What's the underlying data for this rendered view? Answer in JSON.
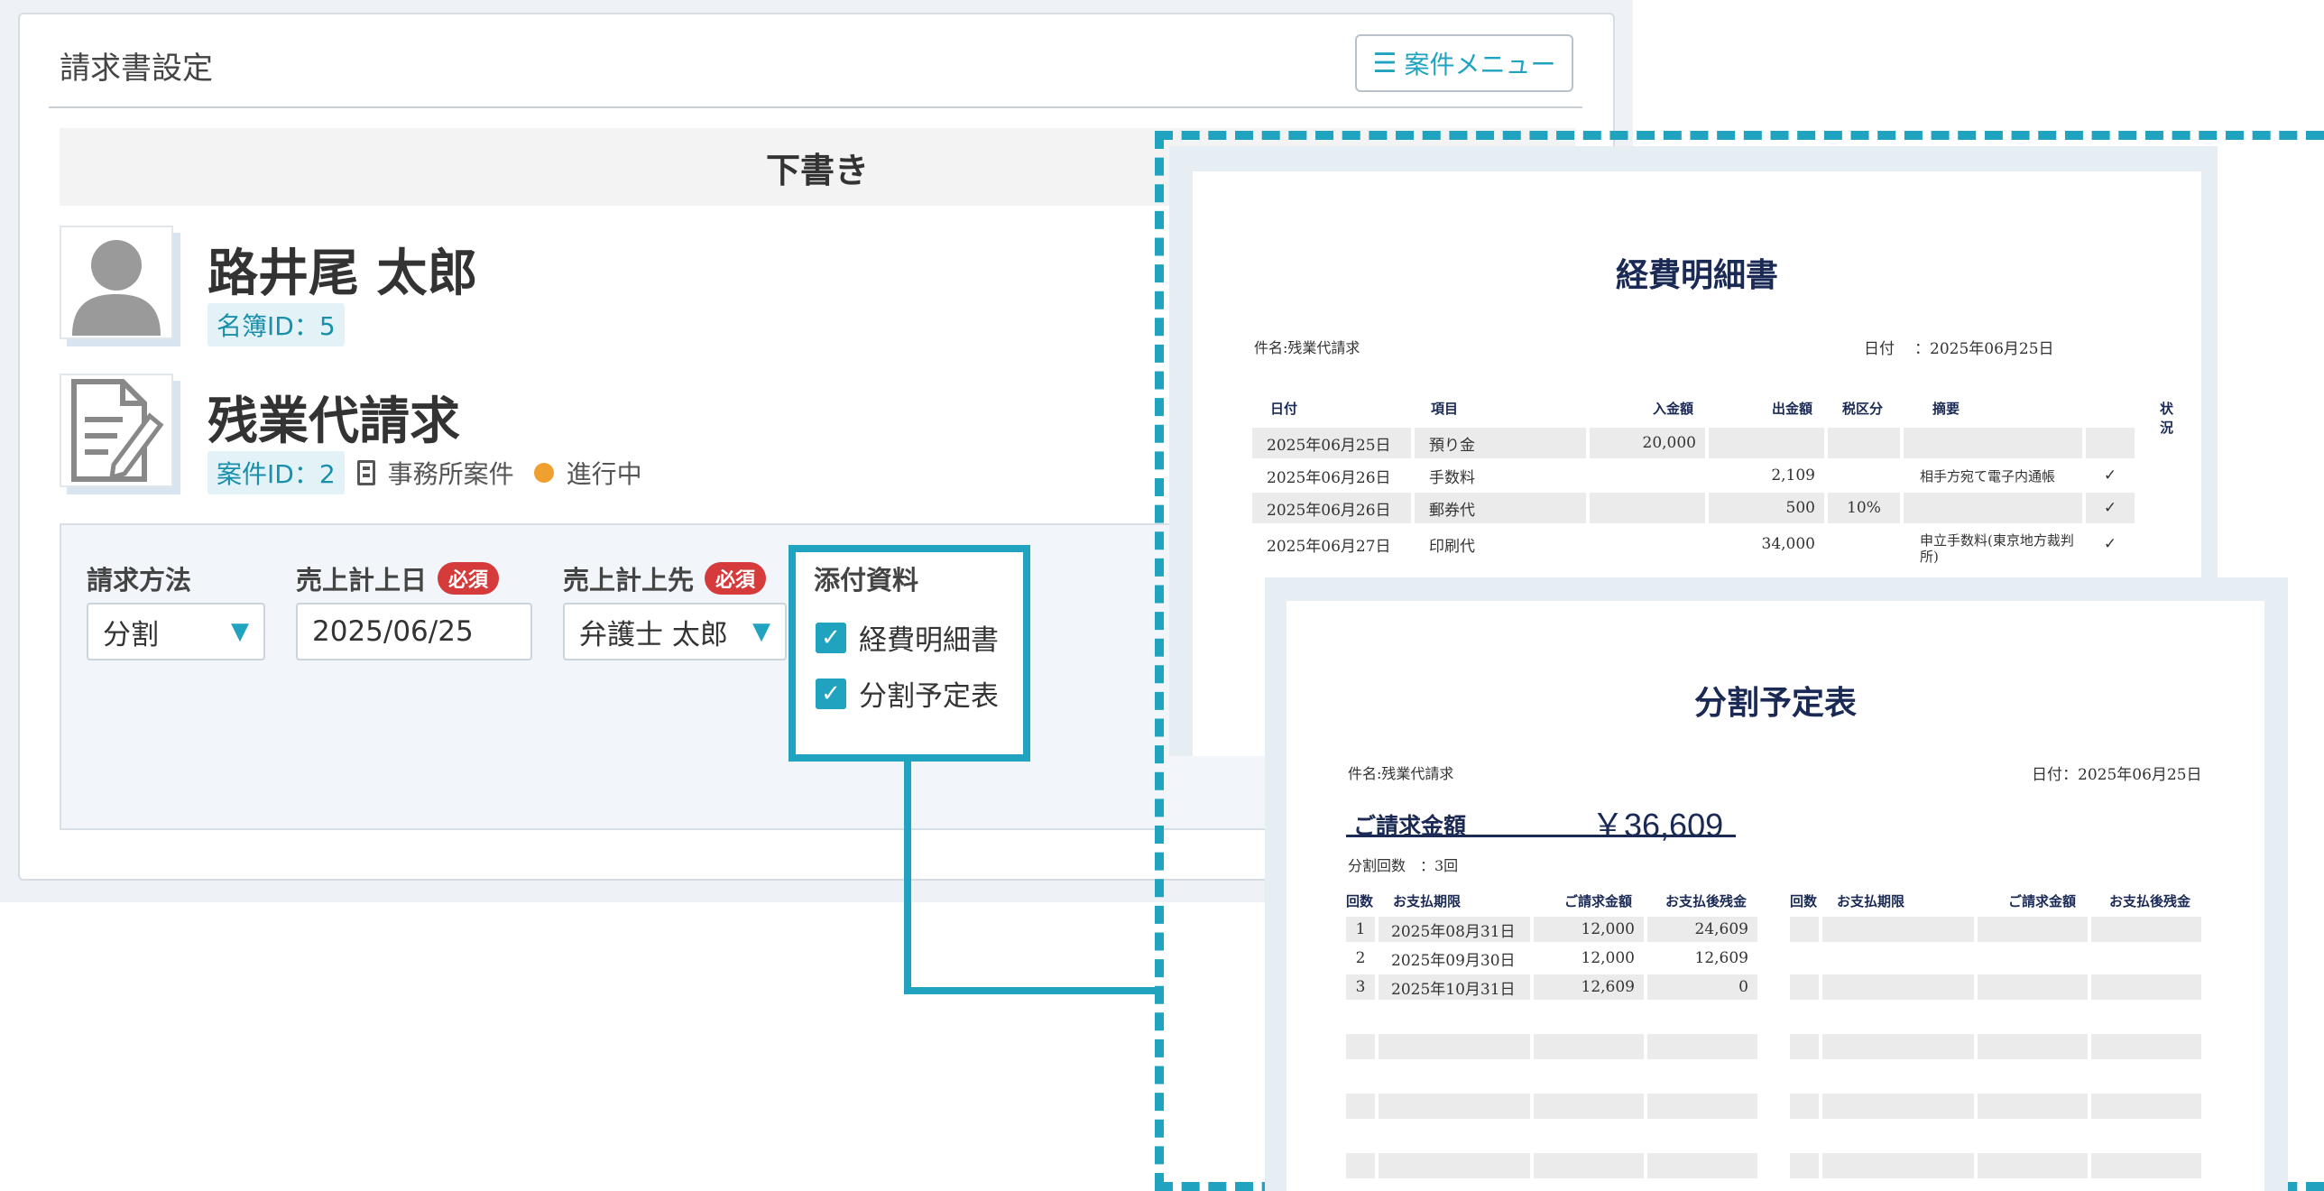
{
  "panel": {
    "title": "請求書設定",
    "menu_label": "案件メニュー",
    "status_bar": "下書き"
  },
  "client": {
    "name": "路井尾 太郎",
    "id_label": "名簿ID：5"
  },
  "case": {
    "title": "残業代請求",
    "id_label": "案件ID：2",
    "type_label": "事務所案件",
    "status_label": "進行中",
    "status_color": "#f0a030"
  },
  "form": {
    "method_label": "請求方法",
    "method_value": "分割",
    "date_label": "売上計上日",
    "date_value": "2025/06/25",
    "required_badge": "必須",
    "dest_label": "売上計上先",
    "dest_value": "弁護士 太郎",
    "attach_label": "添付資料",
    "attachments": [
      {
        "label": "経費明細書",
        "checked": true
      },
      {
        "label": "分割予定表",
        "checked": true
      }
    ]
  },
  "expense_doc": {
    "title": "経費明細書",
    "subject": "件名:残業代請求",
    "date_label": "日付",
    "date_value": "：2025年06月25日",
    "headers": [
      "日付",
      "項目",
      "入金額",
      "出金額",
      "税区分",
      "摘要",
      "状況"
    ],
    "rows": [
      {
        "date": "2025年06月25日",
        "item": "預り金",
        "in": "20,000",
        "out": "",
        "tax": "",
        "note": "",
        "status": ""
      },
      {
        "date": "2025年06月26日",
        "item": "手数料",
        "in": "",
        "out": "2,109",
        "tax": "",
        "note": "相手方宛て電子内通帳",
        "status": "✓"
      },
      {
        "date": "2025年06月26日",
        "item": "郵券代",
        "in": "",
        "out": "500",
        "tax": "10%",
        "note": "",
        "status": "✓"
      },
      {
        "date": "2025年06月27日",
        "item": "印刷代",
        "in": "",
        "out": "34,000",
        "tax": "",
        "note": "申立手数料(東京地方裁判所)",
        "status": "✓"
      }
    ]
  },
  "schedule_doc": {
    "title": "分割予定表",
    "subject": "件名:残業代請求",
    "date": "日付：2025年06月25日",
    "amount_label": "ご請求金額",
    "amount_value": "￥36,609",
    "count_label": "分割回数　：3回",
    "headers": [
      "回数",
      "お支払期限",
      "ご請求金額",
      "お支払後残金"
    ],
    "rows": [
      {
        "no": "1",
        "due": "2025年08月31日",
        "amount": "12,000",
        "remain": "24,609"
      },
      {
        "no": "2",
        "due": "2025年09月30日",
        "amount": "12,000",
        "remain": "12,609"
      },
      {
        "no": "3",
        "due": "2025年10月31日",
        "amount": "12,609",
        "remain": "0"
      }
    ]
  },
  "colors": {
    "accent": "#1fa3bf",
    "required": "#d63b3b",
    "doc_title": "#1a2a55"
  }
}
